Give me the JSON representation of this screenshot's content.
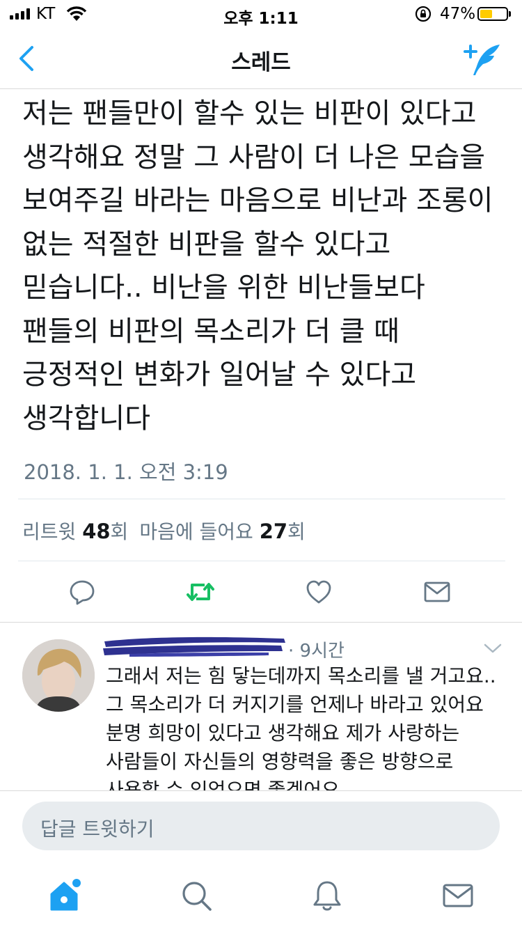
{
  "status_bar": {
    "carrier": "KT",
    "time": "오후 1:11",
    "battery_percent": "47%",
    "battery_level": 0.47
  },
  "nav": {
    "title": "스레드",
    "back_icon": "chevron-left-icon",
    "compose_icon": "compose-tweet-icon"
  },
  "tweet": {
    "text": "저는 팬들만이 할수 있는 비판이 있다고\n생각해요 정말 그 사람이 더 나은 모습을\n보여주길 바라는 마음으로 비난과 조롱이\n없는 적절한 비판을 할수 있다고\n믿습니다.. 비난을 위한 비난들보다\n팬들의 비판의 목소리가 더 클 때\n긍정적인 변화가 일어날 수 있다고\n생각합니다",
    "date": "2018. 1. 1. 오전 3:19",
    "retweet_label": "리트윗",
    "retweet_count": "48",
    "retweet_unit": "회",
    "like_label": "마음에 들어요",
    "like_count": "27",
    "like_unit": "회",
    "retweet_color": "#17bf63"
  },
  "reply": {
    "time": "· 9시간",
    "text": "그래서 저는 힘 닿는데까지 목소리를 낼 거고요..\n그 목소리가 더 커지기를 언제나 바라고 있어요\n분명 희망이 있다고 생각해요 제가 사랑하는\n사람들이 자신들의 영향력을 좋은 방향으로\n사용할 수 있었으면 좋겠어요"
  },
  "reply_bar": {
    "placeholder": "답글 트윗하기"
  },
  "tabs": [
    "home-icon",
    "search-icon",
    "notifications-icon",
    "messages-icon"
  ],
  "accent_color": "#1da1f2"
}
